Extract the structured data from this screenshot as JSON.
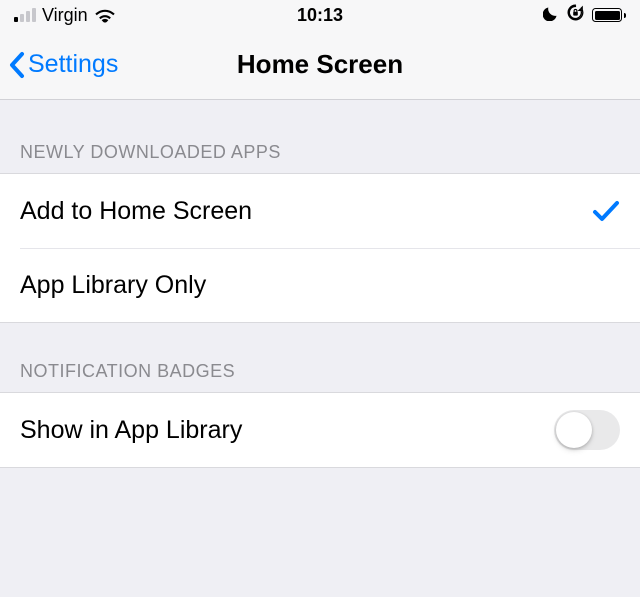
{
  "statusBar": {
    "carrier": "Virgin",
    "time": "10:13"
  },
  "nav": {
    "back": "Settings",
    "title": "Home Screen"
  },
  "sections": {
    "newApps": {
      "header": "NEWLY DOWNLOADED APPS",
      "options": [
        {
          "label": "Add to Home Screen",
          "selected": true
        },
        {
          "label": "App Library Only",
          "selected": false
        }
      ]
    },
    "badges": {
      "header": "NOTIFICATION BADGES",
      "row": {
        "label": "Show in App Library",
        "on": false
      }
    }
  }
}
